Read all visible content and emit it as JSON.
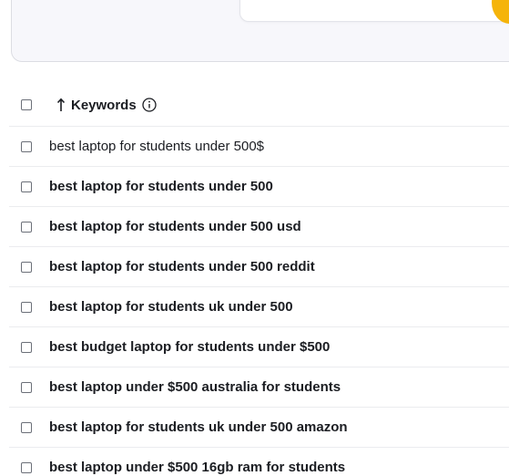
{
  "table": {
    "header": {
      "keywords_label": "Keywords"
    },
    "rows": [
      {
        "keyword": "best laptop for students under 500$",
        "bold": false
      },
      {
        "keyword": "best laptop for students under 500",
        "bold": true
      },
      {
        "keyword": "best laptop for students under 500 usd",
        "bold": true
      },
      {
        "keyword": "best laptop for students under 500 reddit",
        "bold": true
      },
      {
        "keyword": "best laptop for students uk under 500",
        "bold": true
      },
      {
        "keyword": "best budget laptop for students under $500",
        "bold": true
      },
      {
        "keyword": "best laptop under $500 australia for students",
        "bold": true
      },
      {
        "keyword": "best laptop for students uk under 500 amazon",
        "bold": true
      },
      {
        "keyword": "best laptop under $500 16gb ram for students",
        "bold": true
      }
    ]
  },
  "icons": {
    "sort": "arrow-up-icon",
    "info": "info-icon"
  }
}
